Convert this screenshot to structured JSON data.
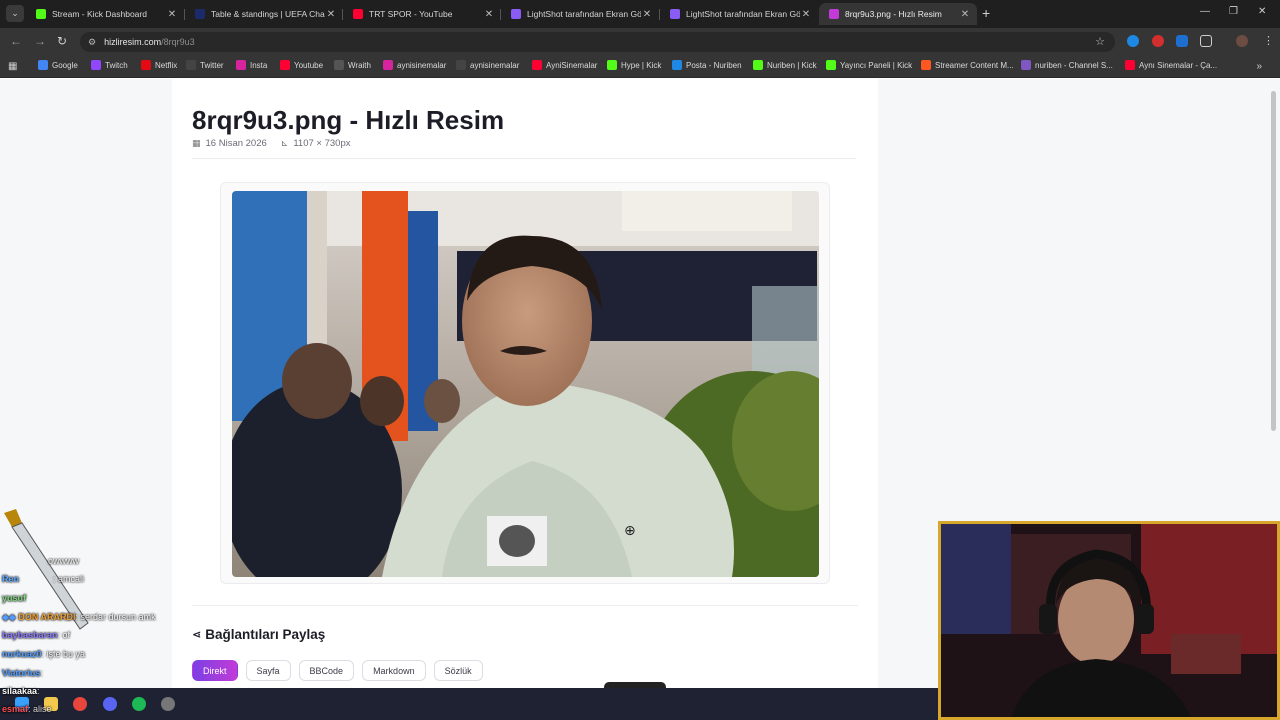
{
  "browser": {
    "tabs": [
      {
        "title": "Stream - Kick Dashboard",
        "favicon_color": "#53fc18",
        "active": false
      },
      {
        "title": "Table & standings | UEFA Cham",
        "favicon_color": "#1b2a6b",
        "active": false
      },
      {
        "title": "TRT SPOR - YouTube",
        "favicon_color": "#ff0033",
        "active": false
      },
      {
        "title": "LightShot tarafından Ekran Gön",
        "favicon_color": "#8a5cf6",
        "active": false
      },
      {
        "title": "LightShot tarafından Ekran Gön",
        "favicon_color": "#8a5cf6",
        "active": false
      },
      {
        "title": "8rqr9u3.png - Hızlı Resim",
        "favicon_color": "#c23bd8",
        "active": true
      }
    ],
    "url_host": "hizliresim.com",
    "url_path": "/8rqr9u3",
    "bookmarks": [
      {
        "label": "Google",
        "color": "#4285f4"
      },
      {
        "label": "Twitch",
        "color": "#9146ff"
      },
      {
        "label": "Netflix",
        "color": "#e50914"
      },
      {
        "label": "Twitter",
        "color": "#444444"
      },
      {
        "label": "Insta",
        "color": "#d6249f"
      },
      {
        "label": "Youtube",
        "color": "#ff0033"
      },
      {
        "label": "Wraith",
        "color": "#555555"
      },
      {
        "label": "aynisinemalar",
        "color": "#d6249f"
      },
      {
        "label": "aynisinemalar",
        "color": "#444444"
      },
      {
        "label": "AyniSinemalar",
        "color": "#ff0033"
      },
      {
        "label": "Hype | Kick",
        "color": "#53fc18"
      },
      {
        "label": "Posta - Nuriben",
        "color": "#1e88e5"
      },
      {
        "label": "Nuriben | Kick",
        "color": "#53fc18"
      },
      {
        "label": "Yayıncı Paneli | Kick",
        "color": "#53fc18"
      },
      {
        "label": "Streamer Content M...",
        "color": "#ff5722"
      },
      {
        "label": "nuriben - Channel S...",
        "color": "#7e57c2"
      },
      {
        "label": "Aynı Sinemalar - Ça...",
        "color": "#ff0033"
      }
    ]
  },
  "page": {
    "title": "8rqr9u3.png - Hızlı Resim",
    "date": "16 Nisan 2026",
    "dimensions": "1107 × 730px",
    "share_title": "Bağlantıları Paylaş",
    "share_tabs": [
      "Direkt",
      "Sayfa",
      "BBCode",
      "Markdown",
      "Sözlük"
    ],
    "active_share_tab": "Direkt"
  },
  "chat": [
    {
      "user": "",
      "message": "owwww",
      "color": "#a6a6a6"
    },
    {
      "user": "Ren",
      "message": ": amcali",
      "color": "#5aa9ff"
    },
    {
      "user": "yusuf",
      "message": "",
      "color": "#7cd67c"
    },
    {
      "user": "DON   ARARDI",
      "message": ": serdar dursun amk",
      "color": "#f0a030"
    },
    {
      "user": "baybasbaran",
      "message": ": of",
      "color": "#8a7dff"
    },
    {
      "user": "nurkuaz0",
      "message": ": işte bu ya",
      "color": "#4f9bff"
    },
    {
      "user": "Viatorius",
      "message": ":",
      "color": "#4f9bff"
    },
    {
      "user": "silaakaa",
      "message": ":",
      "color": "#ffffff"
    },
    {
      "user": "esmaf",
      "message": ": alise",
      "color": "#ff4d4d"
    }
  ]
}
